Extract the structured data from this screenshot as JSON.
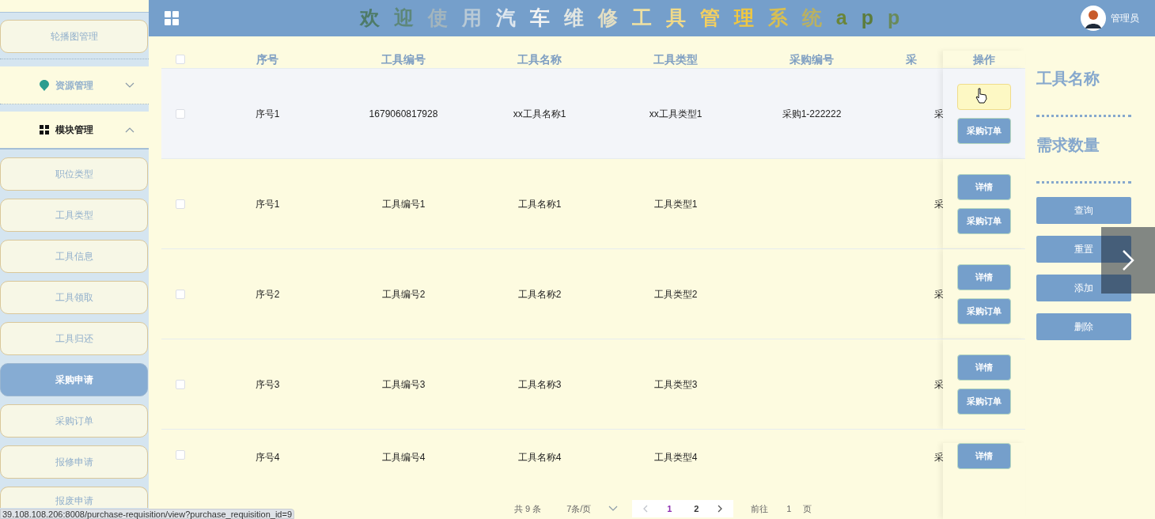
{
  "sidebar": {
    "items": [
      {
        "kind": "link",
        "label": "轮播图管理",
        "selected": false
      },
      {
        "kind": "group",
        "label": "资源管理",
        "expanded": false
      },
      {
        "kind": "group",
        "label": "模块管理",
        "expanded": true,
        "children": [
          {
            "label": "职位类型",
            "selected": false
          },
          {
            "label": "工具类型",
            "selected": false
          },
          {
            "label": "工具信息",
            "selected": false
          },
          {
            "label": "工具领取",
            "selected": false
          },
          {
            "label": "工具归还",
            "selected": false
          },
          {
            "label": "采购申请",
            "selected": true
          },
          {
            "label": "采购订单",
            "selected": false
          },
          {
            "label": "报修申请",
            "selected": false
          },
          {
            "label": "报废申请",
            "selected": false
          }
        ]
      }
    ]
  },
  "header": {
    "title_chars": [
      {
        "text": "欢",
        "color": "#4e7b68"
      },
      {
        "text": "迎",
        "color": "#5d877a"
      },
      {
        "text": "使",
        "color": "#a3b5bd"
      },
      {
        "text": "用",
        "color": "#b9cad6"
      },
      {
        "text": "汽",
        "color": "#dde6ee"
      },
      {
        "text": "车",
        "color": "#f2f3f3"
      },
      {
        "text": "维",
        "color": "#e2e6e2"
      },
      {
        "text": "修",
        "color": "#e4dfc3"
      },
      {
        "text": "工",
        "color": "#eee0a2"
      },
      {
        "text": "具",
        "color": "#f1da88"
      },
      {
        "text": "管",
        "color": "#f3cf5f"
      },
      {
        "text": "理",
        "color": "#efc741"
      },
      {
        "text": "系",
        "color": "#d8bf52"
      },
      {
        "text": "统",
        "color": "#b9b163"
      },
      {
        "text": "a",
        "color": "#6a8538"
      },
      {
        "text": "p",
        "color": "#5c7c3c"
      },
      {
        "text": "p",
        "color": "#698a5a"
      }
    ],
    "user": "管理员"
  },
  "table": {
    "select_all_checked": false,
    "columns": [
      "序号",
      "工具编号",
      "工具名称",
      "工具类型",
      "采购编号",
      "采"
    ],
    "action_column": "操作",
    "rows": [
      {
        "checked": false,
        "highlighted": true,
        "cells": [
          "序号1",
          "1679060817928",
          "xx工具名称1",
          "xx工具类型1",
          "采购1-222222",
          "采"
        ],
        "actions": [
          {
            "hovered": true
          },
          {
            "label": "采购订单",
            "hovered": false
          }
        ]
      },
      {
        "checked": false,
        "highlighted": false,
        "cells": [
          "序号1",
          "工具编号1",
          "工具名称1",
          "工具类型1",
          "",
          "采"
        ],
        "actions": [
          {
            "label": "详情",
            "hovered": false
          },
          {
            "label": "采购订单",
            "hovered": false
          }
        ]
      },
      {
        "checked": false,
        "highlighted": false,
        "cells": [
          "序号2",
          "工具编号2",
          "工具名称2",
          "工具类型2",
          "",
          "采"
        ],
        "actions": [
          {
            "label": "详情",
            "hovered": false
          },
          {
            "label": "采购订单",
            "hovered": false
          }
        ]
      },
      {
        "checked": false,
        "highlighted": false,
        "cells": [
          "序号3",
          "工具编号3",
          "工具名称3",
          "工具类型3",
          "",
          "采"
        ],
        "actions": [
          {
            "label": "详情",
            "hovered": false
          },
          {
            "label": "采购订单",
            "hovered": false
          }
        ]
      },
      {
        "checked": false,
        "highlighted": false,
        "cells": [
          "序号4",
          "工具编号4",
          "工具名称4",
          "工具类型4",
          "",
          "采"
        ],
        "actions": [
          {
            "label": "详情",
            "hovered": false
          }
        ]
      }
    ]
  },
  "pagination": {
    "total": "共 9 条",
    "page_size": "7条/页",
    "pages": [
      {
        "label": "1",
        "selected": true
      },
      {
        "label": "2",
        "selected": false
      }
    ],
    "goto_label": "前往",
    "goto_value": "1",
    "goto_suffix": "页"
  },
  "search_panel": {
    "fields": [
      {
        "label": "工具名称"
      },
      {
        "label": "需求数量"
      }
    ],
    "buttons": [
      "查询",
      "重置",
      "添加",
      "删除"
    ]
  },
  "status_bar": "39.108.108.206:8008/purchase-requisition/view?purchase_requisition_id=9"
}
